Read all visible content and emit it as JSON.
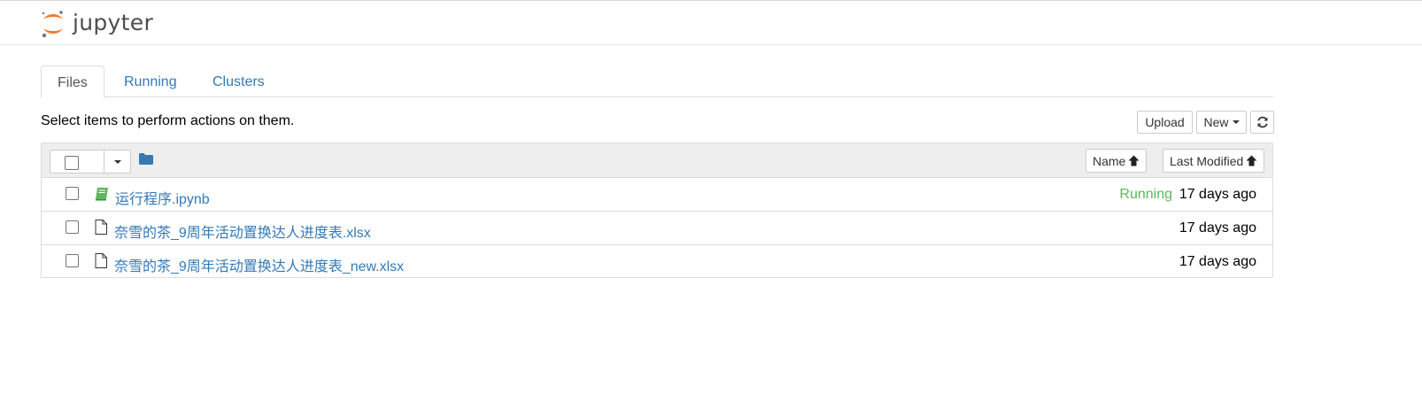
{
  "header": {
    "logo_text": "jupyter"
  },
  "tabs": [
    {
      "label": "Files",
      "active": true
    },
    {
      "label": "Running",
      "active": false
    },
    {
      "label": "Clusters",
      "active": false
    }
  ],
  "toolbar": {
    "message": "Select items to perform actions on them.",
    "upload_label": "Upload",
    "new_label": "New",
    "refresh_icon": "refresh-icon"
  },
  "list_header": {
    "sort_name_label": "Name",
    "sort_modified_label": "Last Modified",
    "sort_icon": "arrow-up-icon"
  },
  "files": [
    {
      "name": "运行程序.ipynb",
      "type": "notebook",
      "icon": "notebook-icon",
      "status": "Running",
      "modified": "17 days ago"
    },
    {
      "name": "奈雪的茶_9周年活动置换达人进度表.xlsx",
      "type": "file",
      "icon": "file-icon",
      "status": "",
      "modified": "17 days ago"
    },
    {
      "name": "奈雪的茶_9周年活动置换达人进度表_new.xlsx",
      "type": "file",
      "icon": "file-icon",
      "status": "",
      "modified": "17 days ago"
    }
  ],
  "colors": {
    "link": "#337ab7",
    "running": "#5cb85c",
    "logo_orange": "#f37726",
    "logo_gray": "#767677"
  }
}
